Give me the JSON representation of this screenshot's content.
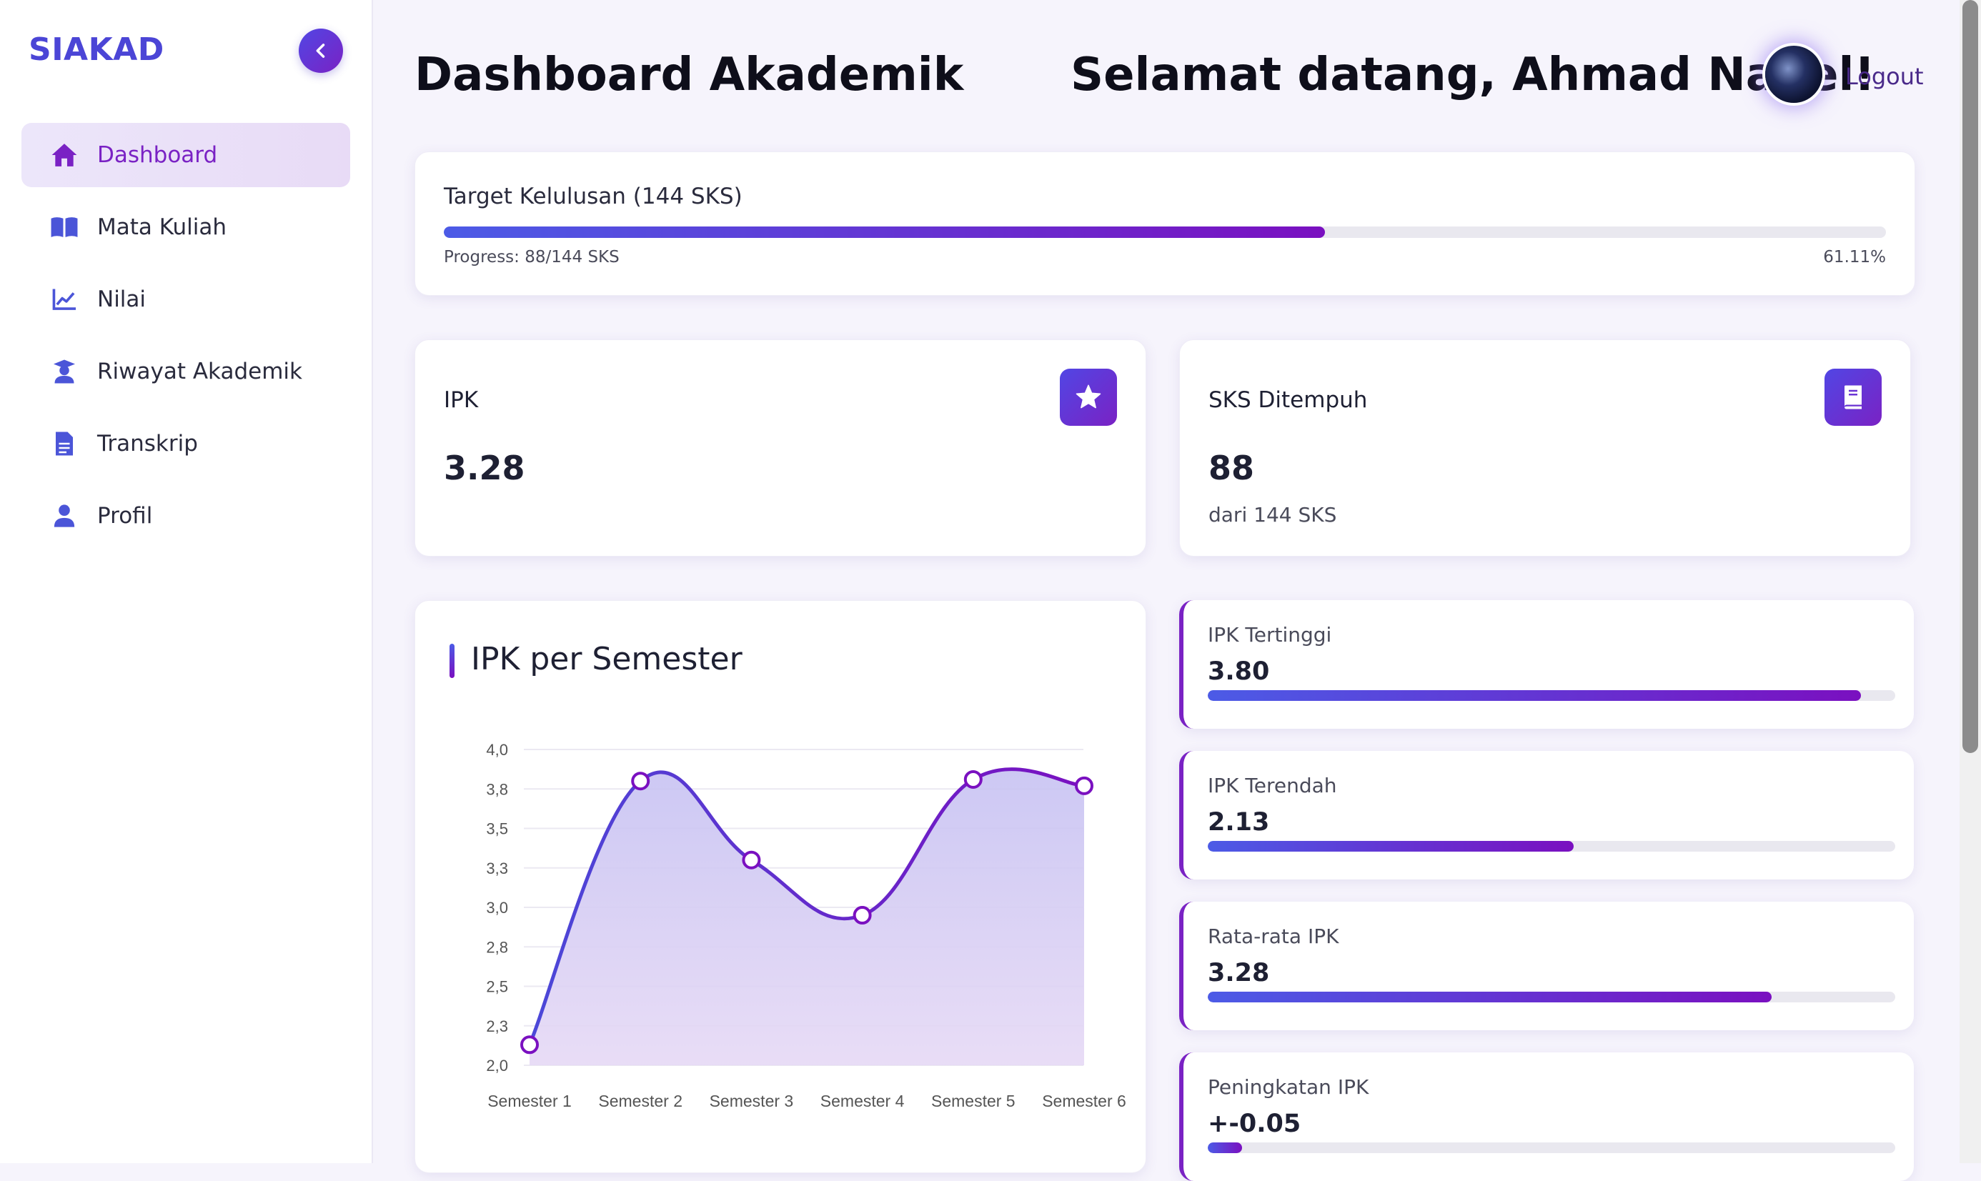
{
  "sidebar": {
    "logo": "SIAKAD",
    "items": [
      {
        "label": "Dashboard",
        "icon": "home-icon",
        "active": true
      },
      {
        "label": "Mata Kuliah",
        "icon": "book-open-icon",
        "active": false
      },
      {
        "label": "Nilai",
        "icon": "line-chart-icon",
        "active": false
      },
      {
        "label": "Riwayat Akademik",
        "icon": "graduate-icon",
        "active": false
      },
      {
        "label": "Transkrip",
        "icon": "document-icon",
        "active": false
      },
      {
        "label": "Profil",
        "icon": "user-icon",
        "active": false
      }
    ]
  },
  "header": {
    "title": "Dashboard Akademik",
    "welcome": "Selamat datang, Ahmad Naael!",
    "logout": "Logout"
  },
  "target": {
    "title": "Target Kelulusan (144 SKS)",
    "progress_text": "Progress: 88/144 SKS",
    "percent_text": "61.11%",
    "fraction": 0.6111
  },
  "stats": {
    "ipk": {
      "label": "IPK",
      "value": "3.28",
      "icon": "star-icon"
    },
    "sks": {
      "label": "SKS Ditempuh",
      "value": "88",
      "sub": "dari 144 SKS",
      "icon": "book-icon"
    }
  },
  "chart_title": "IPK per Semester",
  "chart_data": {
    "type": "area",
    "categories": [
      "Semester 1",
      "Semester 2",
      "Semester 3",
      "Semester 4",
      "Semester 5",
      "Semester 6"
    ],
    "values": [
      2.13,
      3.8,
      3.3,
      2.95,
      3.81,
      3.77
    ],
    "ylim": [
      2.0,
      4.0
    ],
    "yticks": [
      "2,0",
      "2,3",
      "2,5",
      "2,8",
      "3,0",
      "3,3",
      "3,5",
      "3,8",
      "4,0"
    ],
    "colors": {
      "line": "#6a2fd0",
      "fill": "#c9c3f0",
      "point_border": "#7a10c0"
    }
  },
  "summary": [
    {
      "label": "IPK Tertinggi",
      "value": "3.80",
      "fraction": 0.95
    },
    {
      "label": "IPK Terendah",
      "value": "2.13",
      "fraction": 0.532
    },
    {
      "label": "Rata-rata IPK",
      "value": "3.28",
      "fraction": 0.82
    },
    {
      "label": "Peningkatan IPK",
      "value": "+-0.05",
      "fraction": 0.05
    }
  ]
}
